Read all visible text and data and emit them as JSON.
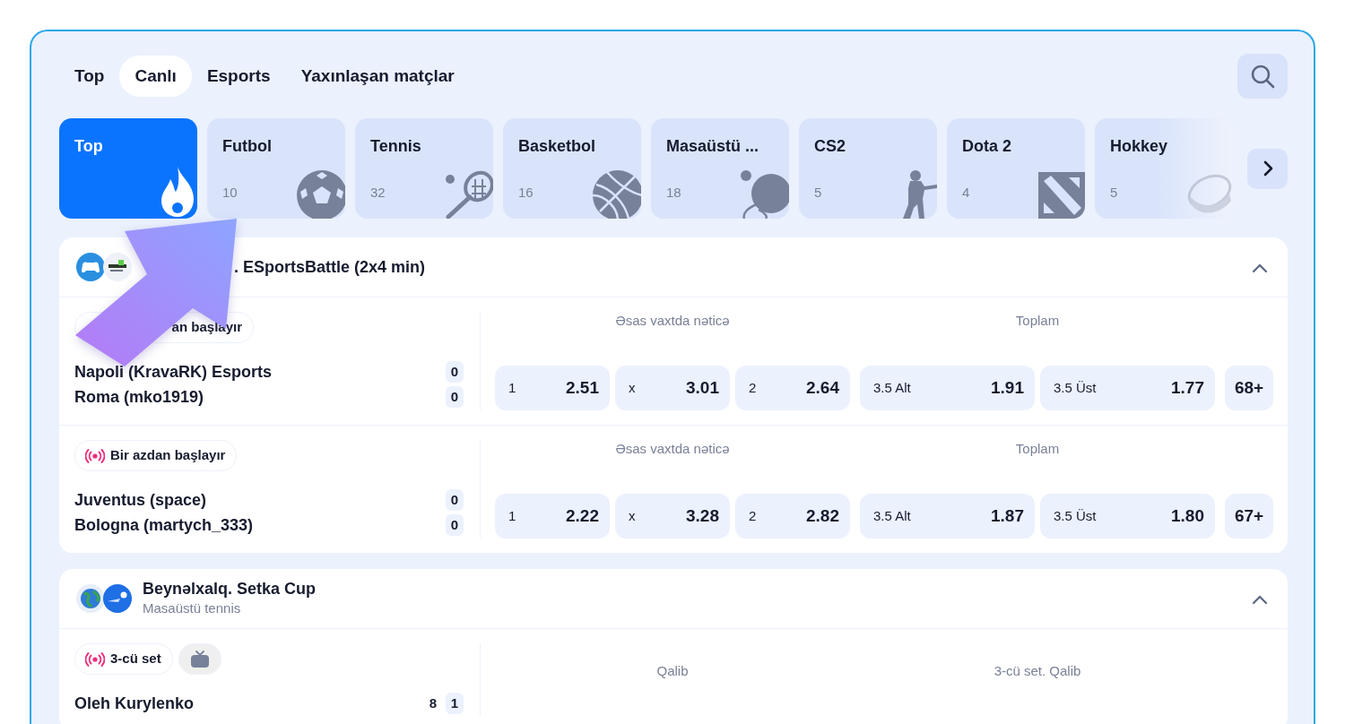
{
  "nav_tabs": [
    {
      "label": "Top",
      "selected": false
    },
    {
      "label": "Canlı",
      "selected": true
    },
    {
      "label": "Esports",
      "selected": false
    },
    {
      "label": "Yaxınlaşan matçlar",
      "selected": false
    }
  ],
  "sports": [
    {
      "kind": "fire",
      "name": "Top",
      "selected": true
    },
    {
      "kind": "soccer",
      "name": "Futbol",
      "count": "10",
      "selected": false
    },
    {
      "kind": "tennis",
      "name": "Tennis",
      "count": "32",
      "selected": false
    },
    {
      "kind": "basketball",
      "name": "Basketbol",
      "count": "16",
      "selected": false
    },
    {
      "kind": "tabletennis",
      "name": "Masaüstü ...",
      "count": "18",
      "selected": false
    },
    {
      "kind": "soldier",
      "name": "CS2",
      "count": "5",
      "selected": false
    },
    {
      "kind": "dota",
      "name": "Dota 2",
      "count": "4",
      "selected": false
    },
    {
      "kind": "puck",
      "name": "Hokkey",
      "count": "5",
      "selected": false,
      "faded": true
    }
  ],
  "leagues": [
    {
      "logos": [
        {
          "kind": "gamepad"
        },
        {
          "kind": "emblem"
        }
      ],
      "title": ". ESportsBattle (2x4 min)",
      "expanded": true,
      "matches": [
        {
          "status": {
            "text": "an başlayır"
          },
          "teams": [
            {
              "name": "Napoli (KravaRK) Esports",
              "scores": [
                {
                  "value": "0",
                  "current": true
                }
              ]
            },
            {
              "name": "Roma (mko1919)",
              "scores": [
                {
                  "value": "0",
                  "current": true
                }
              ]
            }
          ],
          "markets": [
            {
              "title": "Əsas vaxtda nəticə",
              "odds": [
                {
                  "label": "1",
                  "value": "2.51"
                },
                {
                  "label": "x",
                  "value": "3.01"
                },
                {
                  "label": "2",
                  "value": "2.64"
                }
              ]
            },
            {
              "title": "Toplam",
              "odds": [
                {
                  "label": "3.5 Alt",
                  "value": "1.91"
                },
                {
                  "label": "3.5 Üst",
                  "value": "1.77"
                }
              ]
            }
          ],
          "more": "68+"
        },
        {
          "status": {
            "text": "Bir azdan başlayır",
            "live": true
          },
          "teams": [
            {
              "name": "Juventus (space)",
              "scores": [
                {
                  "value": "0",
                  "current": true
                }
              ]
            },
            {
              "name": "Bologna (martych_333)",
              "scores": [
                {
                  "value": "0",
                  "current": true
                }
              ]
            }
          ],
          "markets": [
            {
              "title": "Əsas vaxtda nəticə",
              "odds": [
                {
                  "label": "1",
                  "value": "2.22"
                },
                {
                  "label": "x",
                  "value": "3.28"
                },
                {
                  "label": "2",
                  "value": "2.82"
                }
              ]
            },
            {
              "title": "Toplam",
              "odds": [
                {
                  "label": "3.5 Alt",
                  "value": "1.87"
                },
                {
                  "label": "3.5 Üst",
                  "value": "1.80"
                }
              ]
            }
          ],
          "more": "67+"
        }
      ]
    },
    {
      "logos": [
        {
          "kind": "globe"
        },
        {
          "kind": "pingpong"
        }
      ],
      "title": "Beynəlxalq. Setka Cup",
      "subtitle": "Masaüstü tennis",
      "expanded": true,
      "matches": [
        {
          "status": {
            "text": "3-cü set",
            "live": true
          },
          "tv": true,
          "teams": [
            {
              "name": "Oleh Kurylenko",
              "scores": [
                {
                  "value": "8",
                  "current": false
                },
                {
                  "value": "1",
                  "current": true
                }
              ]
            }
          ],
          "markets": [
            {
              "title": "Qalib"
            },
            {
              "title": "3-cü set. Qalib"
            }
          ]
        }
      ]
    }
  ]
}
